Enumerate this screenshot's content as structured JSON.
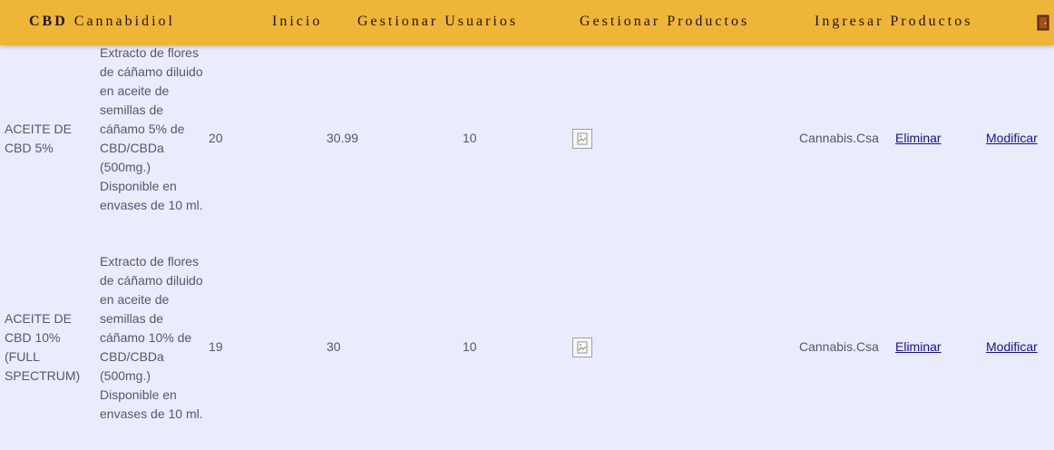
{
  "header": {
    "brand_bold": "CBD",
    "brand_rest": "Cannabidiol",
    "nav": {
      "inicio": "Inicio",
      "usuarios": "Gestionar Usuarios",
      "productos": "Gestionar Productos",
      "ingresar": "Ingresar Productos"
    },
    "exit_icon": "door-icon"
  },
  "colors": {
    "header_bg": "#efb536",
    "page_bg": "#e8ecfb",
    "link": "#1a0dab"
  },
  "products": [
    {
      "name": "ACEITE DE CBD 5%",
      "description": "Extracto de flores de cáñamo diluido en aceite de semillas de cáñamo 5% de CBD/CBDa (500mg.) Disponible en envases de 10 ml.",
      "stock": "20",
      "price": "30.99",
      "discount": "10",
      "image_icon": "broken-image-icon",
      "provider": "Cannabis.Csa",
      "delete_label": "Eliminar",
      "modify_label": "Modificar"
    },
    {
      "name": "ACEITE DE CBD 10% (FULL SPECTRUM)",
      "description": "Extracto de flores de cáñamo diluido en aceite de semillas de cáñamo 10% de CBD/CBDa (500mg.) Disponible en envases de 10 ml.",
      "stock": "19",
      "price": "30",
      "discount": "10",
      "image_icon": "broken-image-icon",
      "provider": "Cannabis.Csa",
      "delete_label": "Eliminar",
      "modify_label": "Modificar"
    }
  ]
}
